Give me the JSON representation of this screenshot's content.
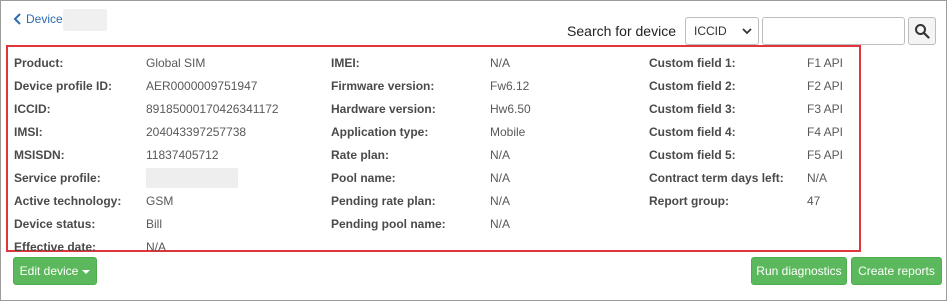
{
  "breadcrumb": {
    "back_label": "Devices"
  },
  "search": {
    "label": "Search for device",
    "type_selected": "ICCID",
    "query_value": ""
  },
  "details": {
    "col1": [
      {
        "label": "Product:",
        "value": "Global SIM"
      },
      {
        "label": "Device profile ID:",
        "value": "AER0000009751947"
      },
      {
        "label": "ICCID:",
        "value": "89185000170426341172"
      },
      {
        "label": "IMSI:",
        "value": "204043397257738"
      },
      {
        "label": "MSISDN:",
        "value": "11837405712"
      },
      {
        "label": "Service profile:",
        "value": ""
      },
      {
        "label": "Active technology:",
        "value": "GSM"
      },
      {
        "label": "Device status:",
        "value": "Bill"
      },
      {
        "label": "Effective date:",
        "value": "N/A"
      }
    ],
    "col2": [
      {
        "label": "IMEI:",
        "value": "N/A"
      },
      {
        "label": "Firmware version:",
        "value": "Fw6.12"
      },
      {
        "label": "Hardware version:",
        "value": "Hw6.50"
      },
      {
        "label": "Application type:",
        "value": "Mobile"
      },
      {
        "label": "Rate plan:",
        "value": "N/A"
      },
      {
        "label": "Pool name:",
        "value": "N/A"
      },
      {
        "label": "Pending rate plan:",
        "value": "N/A"
      },
      {
        "label": "Pending pool name:",
        "value": "N/A"
      }
    ],
    "col3": [
      {
        "label": "Custom field 1:",
        "value": "F1 API"
      },
      {
        "label": "Custom field 2:",
        "value": "F2 API"
      },
      {
        "label": "Custom field 3:",
        "value": "F3 API"
      },
      {
        "label": "Custom field 4:",
        "value": "F4 API"
      },
      {
        "label": "Custom field 5:",
        "value": "F5 API"
      },
      {
        "label": "Contract term days left:",
        "value": "N/A"
      },
      {
        "label": "Report group:",
        "value": "47"
      }
    ]
  },
  "actions": {
    "edit_device": "Edit device",
    "run_diagnostics": "Run diagnostics",
    "create_reports": "Create reports"
  },
  "colors": {
    "highlight_border": "#e0353b",
    "button_green": "#5cb85c",
    "link_blue": "#2a6cb0"
  }
}
